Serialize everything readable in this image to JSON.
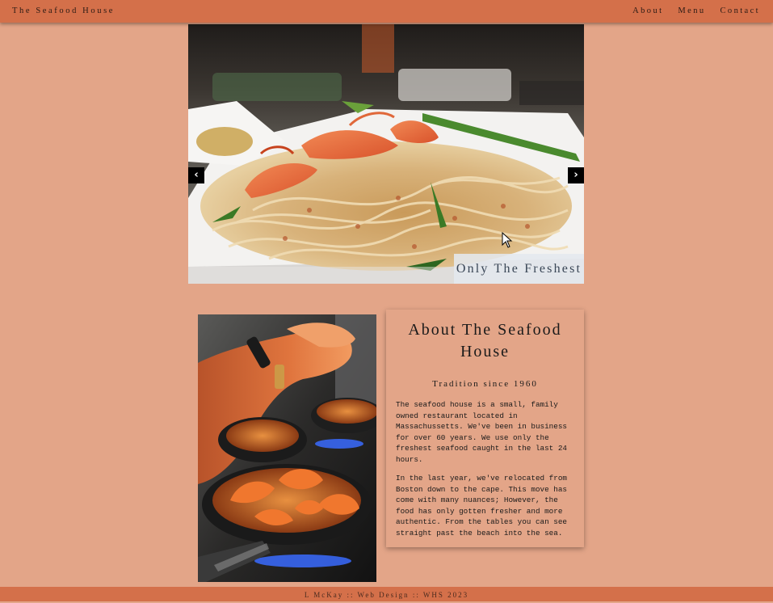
{
  "navbar": {
    "brand": "The Seafood House",
    "links": [
      "About",
      "Menu",
      "Contact"
    ]
  },
  "carousel": {
    "prev_glyph": "‹",
    "next_glyph": "›",
    "caption": "Only The Freshest",
    "image": "shrimp-pad-thai-photo"
  },
  "about": {
    "image": "chef-cooking-shrimp-photo",
    "title": "About The Seafood House",
    "subtitle": "Tradition since 1960",
    "paragraphs": [
      "The seafood house is a small, family owned restaurant located in Massachussetts. We've been in business for over 60 years. We use only the freshest seafood caught in the last 24 hours.",
      "In the last year, we've relocated from Boston down to the cape. This move has come with many nuances; However, the food has only gotten fresher and more authentic. From the tables you can see straight past the beach into the sea."
    ]
  },
  "footer": {
    "text": "L McKay :: Web Design :: WHS 2023"
  },
  "colors": {
    "background": "#e3a588",
    "bar": "#d4704a"
  }
}
